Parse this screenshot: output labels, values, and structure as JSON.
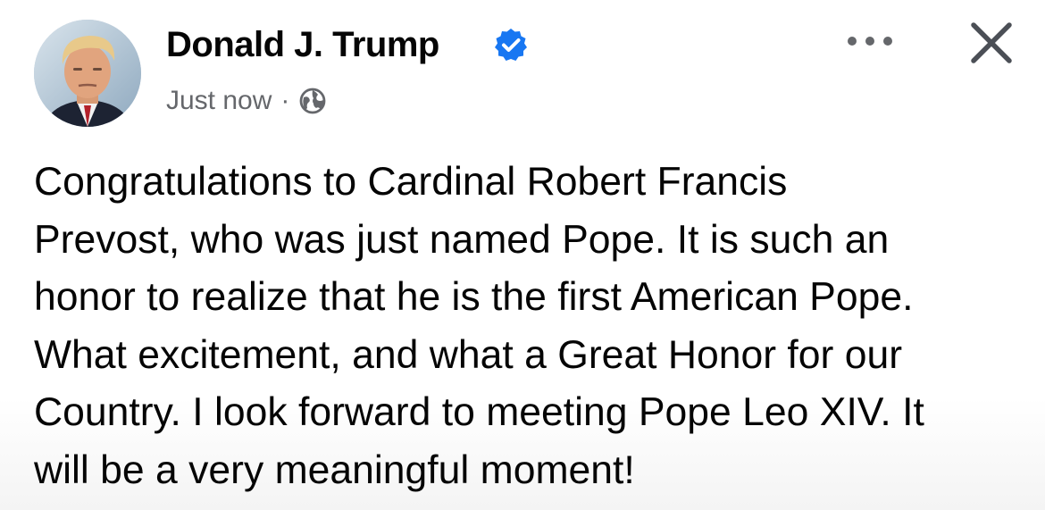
{
  "post": {
    "author": {
      "name": "Donald J. Trump",
      "verified": true,
      "avatar": "profile-photo"
    },
    "meta": {
      "timestamp": "Just now",
      "separator": "·",
      "audience_icon": "globe-icon"
    },
    "actions": {
      "more_icon": "more-horizontal-icon",
      "close_icon": "close-icon"
    },
    "text_lines": [
      "Congratulations to Cardinal Robert Francis",
      "Prevost, who was just named Pope. It is such an",
      "honor to realize that he is the first American Pope.",
      "What excitement, and what a Great Honor for our",
      "Country. I look forward to meeting Pope Leo XIV. It",
      "will be a very meaningful moment!"
    ]
  },
  "colors": {
    "text_primary": "#050505",
    "text_secondary": "#65676b",
    "verified_blue": "#1877f2",
    "icon_gray": "#65676b"
  }
}
